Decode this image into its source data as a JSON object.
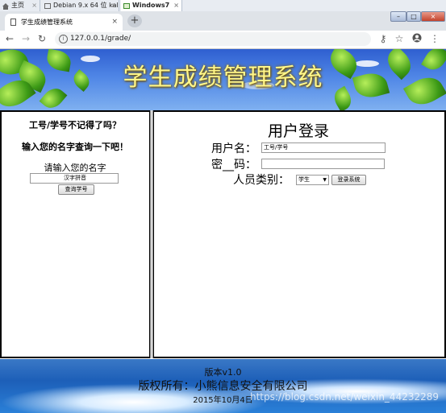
{
  "vm_tabs": [
    {
      "label": "主页",
      "active": false
    },
    {
      "label": "Debian 9.x 64 位 kali",
      "active": false
    },
    {
      "label": "Windows7",
      "active": true
    }
  ],
  "browser": {
    "tab_title": "学生成绩管理系统",
    "url": "127.0.0.1/grade/",
    "new_tab": "+",
    "close": "×"
  },
  "banner": {
    "title": "学生成绩管理系统"
  },
  "lookup": {
    "question": "工号/学号不记得了吗？",
    "prompt": "输入您的名字查询一下吧！",
    "label": "请输入您的名字",
    "input_value": "汉字拼音",
    "button": "查询学号"
  },
  "login": {
    "title": "用户登录",
    "username_label": "用户名：",
    "username_value": "工号/学号",
    "password_label": "密__码：",
    "role_label": "人员类别：",
    "role_selected": "学生",
    "submit": "登录系统"
  },
  "footer": {
    "version": "版本v1.0",
    "copyright": "版权所有：小熊信息安全有限公司",
    "date": "2015年10月4日",
    "watermark": "https://blog.csdn.net/weixin_44232289"
  },
  "colors": {
    "banner_title": "#fff78a",
    "banner_sky": "#4f86e6",
    "footer_sea": "#1d5fb8"
  }
}
